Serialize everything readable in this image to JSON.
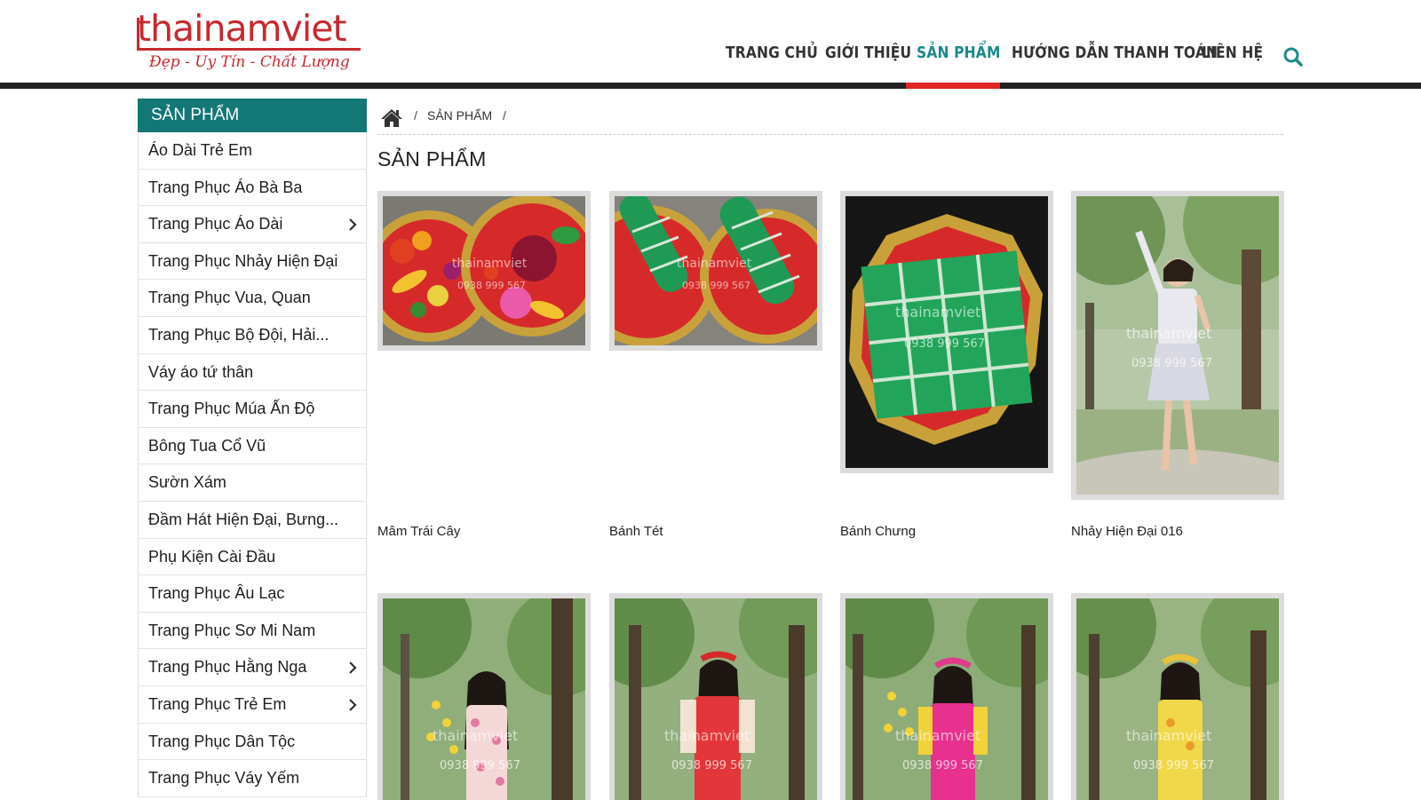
{
  "logo": {
    "name": "thainamviet",
    "slogan": "Đẹp - Uy Tín - Chất Lượng"
  },
  "nav": {
    "items": [
      {
        "label": "TRANG CHỦ"
      },
      {
        "label": "GIỚI THIỆU"
      },
      {
        "label": "SẢN PHẨM"
      },
      {
        "label": "HƯỚNG DẪN THANH TOÁN"
      },
      {
        "label": "LIÊN HỆ"
      }
    ],
    "active_index": 2,
    "search_icon": "search-icon"
  },
  "sidebar": {
    "title": "SẢN PHẨM",
    "items": [
      {
        "label": "Áo Dài Trẻ Em",
        "has_children": false
      },
      {
        "label": "Trang Phục Áo Bà Ba",
        "has_children": false
      },
      {
        "label": "Trang Phục Áo Dài",
        "has_children": true
      },
      {
        "label": "Trang Phục Nhảy Hiện Đại",
        "has_children": false
      },
      {
        "label": "Trang Phục Vua, Quan",
        "has_children": false
      },
      {
        "label": "Trang Phục Bộ Đội, Hải...",
        "has_children": false
      },
      {
        "label": "Váy áo tứ thân",
        "has_children": false
      },
      {
        "label": "Trang Phục Múa Ấn Độ",
        "has_children": false
      },
      {
        "label": "Bông Tua Cổ Vũ",
        "has_children": false
      },
      {
        "label": "Sườn Xám",
        "has_children": false
      },
      {
        "label": "Đầm Hát Hiện Đại, Bưng...",
        "has_children": false
      },
      {
        "label": "Phụ Kiện Cài Đầu",
        "has_children": false
      },
      {
        "label": "Trang Phục Âu Lạc",
        "has_children": false
      },
      {
        "label": "Trang Phục Sơ Mi Nam",
        "has_children": false
      },
      {
        "label": "Trang Phục Hằng Nga",
        "has_children": true
      },
      {
        "label": "Trang Phục Trẻ Em",
        "has_children": true
      },
      {
        "label": "Trang Phục Dân Tộc",
        "has_children": false
      },
      {
        "label": "Trang Phục Váy Yếm",
        "has_children": false
      }
    ]
  },
  "breadcrumb": {
    "home_icon": "home-icon",
    "separator": "/",
    "current": "SẢN PHẨM"
  },
  "page_title": "SẢN PHẨM",
  "watermark": {
    "brand": "thainamviet",
    "phone": "0938 999 567"
  },
  "products": [
    {
      "name": "Mâm Trái Cây"
    },
    {
      "name": "Bánh Tét"
    },
    {
      "name": "Bánh Chưng"
    },
    {
      "name": "Nhảy Hiện Đại 016"
    },
    {
      "name": ""
    },
    {
      "name": ""
    },
    {
      "name": ""
    },
    {
      "name": ""
    }
  ],
  "colors": {
    "accent_teal": "#137776",
    "nav_active": "#1a8a8a",
    "brand_red": "#c8282e",
    "active_underline": "#e02424"
  }
}
